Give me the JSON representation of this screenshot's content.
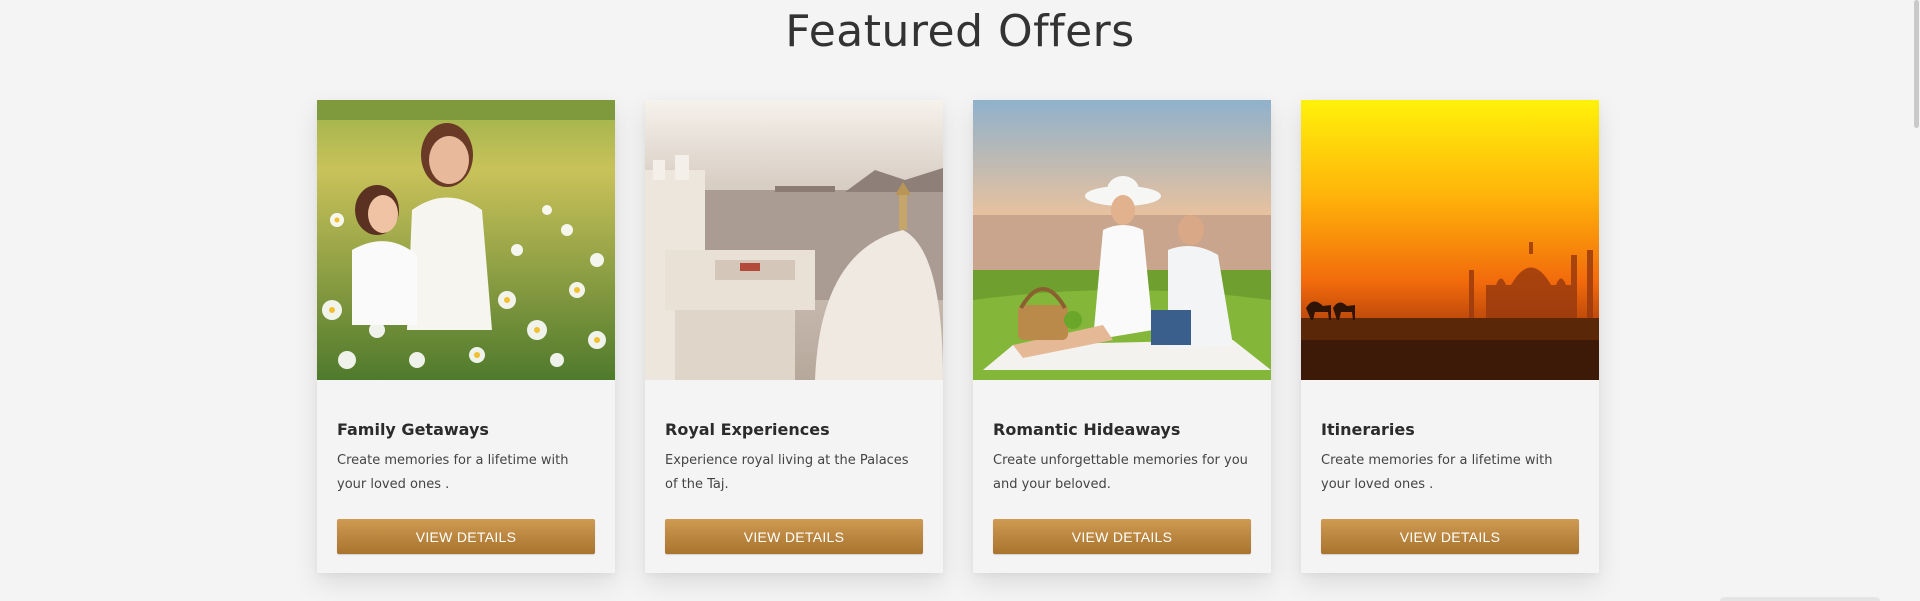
{
  "section": {
    "title": "Featured Offers"
  },
  "offers": [
    {
      "title": "Family Getaways",
      "description": "Create memories for a lifetime with your loved ones .",
      "button_label": "VIEW DETAILS",
      "image_alt": "Mother and daughter in a daisy field"
    },
    {
      "title": "Royal Experiences",
      "description": "Experience royal living at the Palaces of the Taj.",
      "button_label": "VIEW DETAILS",
      "image_alt": "Palace terrace overlooking a lake"
    },
    {
      "title": "Romantic Hideaways",
      "description": "Create unforgettable memories for you and your beloved.",
      "button_label": "VIEW DETAILS",
      "image_alt": "Couple having a picnic by the lake"
    },
    {
      "title": "Itineraries",
      "description": "Create memories for a lifetime with your loved ones .",
      "button_label": "VIEW DETAILS",
      "image_alt": "Sunset silhouette of the Taj Mahal with camels"
    }
  ],
  "colors": {
    "background": "#f4f4f4",
    "button_top": "#cf9a52",
    "button_bottom": "#a8742e",
    "title_text": "#333333"
  }
}
